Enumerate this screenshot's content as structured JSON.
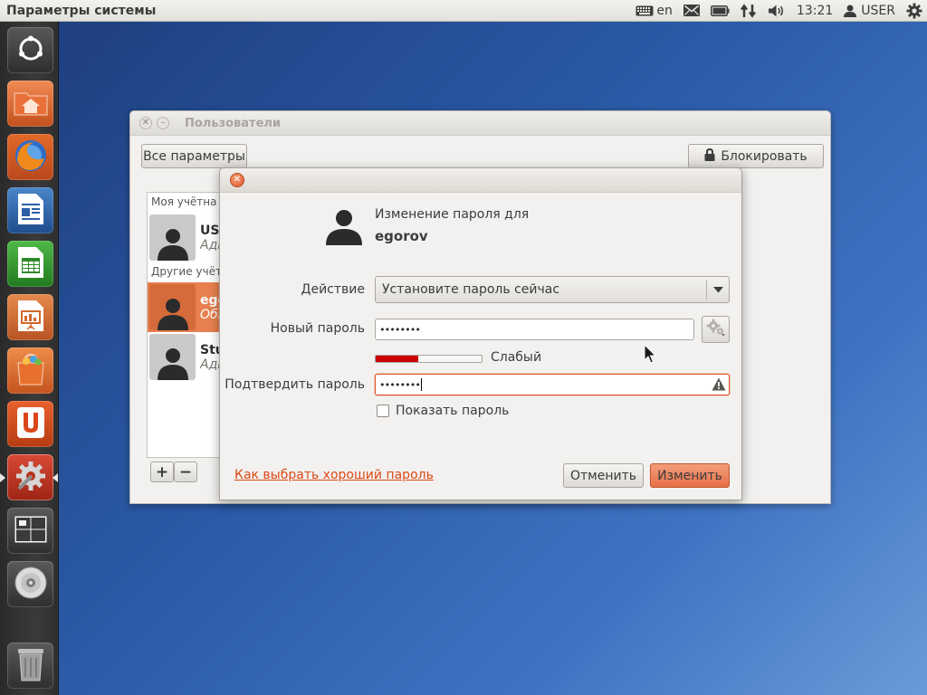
{
  "top_panel": {
    "app_title": "Параметры системы",
    "keyboard_layout": "en",
    "time": "13:21",
    "user": "USER",
    "icons": [
      "keyboard-icon",
      "mail-icon",
      "battery-icon",
      "network-icon",
      "volume-icon",
      "user-icon",
      "gear-icon"
    ]
  },
  "launcher": {
    "items": [
      "dash-icon",
      "files-icon",
      "firefox-icon",
      "writer-icon",
      "calc-icon",
      "impress-icon",
      "software-center-icon",
      "ubuntu-one-icon",
      "system-settings-icon",
      "workspaces-icon",
      "disc-icon",
      "trash-icon"
    ]
  },
  "main_window": {
    "title": "Пользователи",
    "all_settings": "Все параметры",
    "lock": "Блокировать",
    "list": {
      "my_account_header": "Моя учётна",
      "other_accounts_header": "Другие учётн",
      "users": [
        {
          "name": "USI",
          "type": "Адм"
        },
        {
          "name": "ego",
          "type": "Обі"
        },
        {
          "name": "Stu",
          "type": "Адм"
        }
      ]
    },
    "add": "+",
    "remove": "−"
  },
  "dialog": {
    "heading": "Изменение пароля для",
    "username": "egorov",
    "action_label": "Действие",
    "action_value": "Установите пароль сейчас",
    "new_password_label": "Новый пароль",
    "new_password_value": "••••••••",
    "strength": 0.4,
    "strength_label": "Слабый",
    "confirm_label": "Подтвердить пароль",
    "confirm_value": "••••••••",
    "show_password": "Показать пароль",
    "show_password_checked": false,
    "help_link": "Как выбрать хороший пароль",
    "cancel": "Отменить",
    "change": "Изменить"
  },
  "colors": {
    "accent": "#dd4814",
    "selected_row": "#e8804f",
    "strength_weak": "#cc0000"
  }
}
